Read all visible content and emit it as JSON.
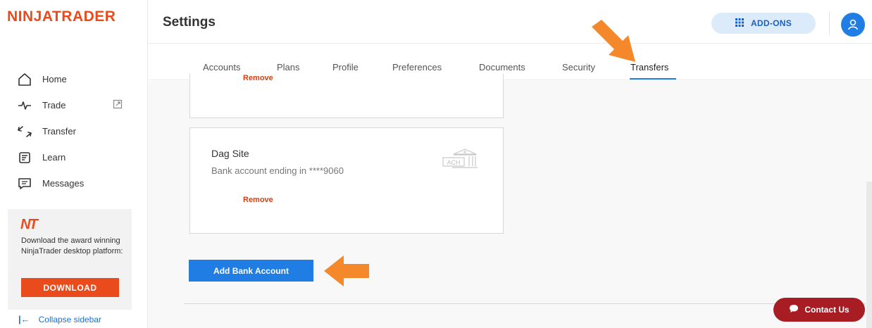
{
  "brand": {
    "logo": "NINJATRADER",
    "accent": "#ea4b1c"
  },
  "sidebar": {
    "items": [
      {
        "label": "Home",
        "icon": "home-icon"
      },
      {
        "label": "Trade",
        "icon": "pulse-icon"
      },
      {
        "label": "Transfer",
        "icon": "transfer-arrows-icon"
      },
      {
        "label": "Learn",
        "icon": "book-icon"
      },
      {
        "label": "Messages",
        "icon": "message-icon"
      }
    ],
    "promo": {
      "logo": "NT",
      "text": "Download the award winning NinjaTrader desktop platform:",
      "button": "DOWNLOAD"
    },
    "collapse_label": "Collapse sidebar"
  },
  "header": {
    "title": "Settings",
    "addons_label": "ADD-ONS"
  },
  "tabs": [
    {
      "label": "Accounts"
    },
    {
      "label": "Plans"
    },
    {
      "label": "Profile"
    },
    {
      "label": "Preferences"
    },
    {
      "label": "Documents"
    },
    {
      "label": "Security"
    },
    {
      "label": "Transfers",
      "active": true
    }
  ],
  "bank_accounts": [
    {
      "remove_label": "Remove"
    },
    {
      "name": "Dag Site",
      "description": "Bank account ending in ****9060",
      "badge": "ACH",
      "remove_label": "Remove"
    }
  ],
  "add_bank_label": "Add Bank Account",
  "contact_label": "Contact Us",
  "colors": {
    "primary": "#1f7de3",
    "contact": "#a81d23",
    "annotation_arrow": "#f5882a"
  }
}
